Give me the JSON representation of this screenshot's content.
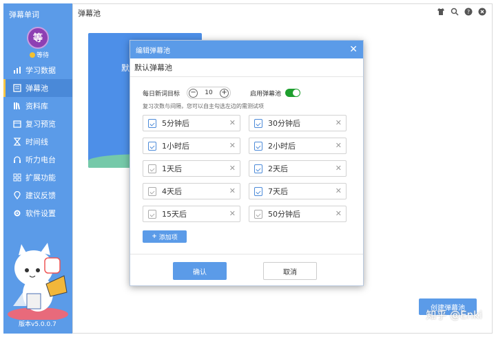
{
  "sidebar": {
    "app_title": "弹幕单词",
    "avatar_char": "等",
    "user_status": "等待",
    "items": [
      {
        "label": "学习数据",
        "icon": "bar-chart-icon"
      },
      {
        "label": "弹幕池",
        "icon": "list-icon"
      },
      {
        "label": "资料库",
        "icon": "books-icon"
      },
      {
        "label": "复习预览",
        "icon": "calendar-icon"
      },
      {
        "label": "时间线",
        "icon": "hourglass-icon"
      },
      {
        "label": "听力电台",
        "icon": "headphones-icon"
      },
      {
        "label": "扩展功能",
        "icon": "grid-icon"
      },
      {
        "label": "建议反馈",
        "icon": "location-icon"
      },
      {
        "label": "软件设置",
        "icon": "gear-icon"
      }
    ],
    "active_index": 1,
    "version": "版本v5.0.0.7"
  },
  "main": {
    "title": "弹幕池",
    "bg_card_text": "默",
    "bottom_button": "创建弹幕池"
  },
  "modal": {
    "title": "编辑弹幕池",
    "pool_name": "默认弹幕池",
    "daily_goal_label": "每日新词目标",
    "daily_goal_value": "10",
    "enable_label": "启用弹幕池",
    "enabled": true,
    "hint": "复习次数与间隔，您可以自主勾选左边的需测试项",
    "review_items": [
      {
        "label": "5分钟后",
        "checked": true
      },
      {
        "label": "30分钟后",
        "checked": true
      },
      {
        "label": "1小时后",
        "checked": true
      },
      {
        "label": "2小时后",
        "checked": true
      },
      {
        "label": "1天后",
        "checked": false
      },
      {
        "label": "2天后",
        "checked": true
      },
      {
        "label": "4天后",
        "checked": false
      },
      {
        "label": "7天后",
        "checked": true
      },
      {
        "label": "15天后",
        "checked": false
      },
      {
        "label": "50分钟后",
        "checked": false
      }
    ],
    "add_label": "添加项",
    "confirm_label": "确认",
    "cancel_label": "取消"
  },
  "watermark": "知乎 @Enki"
}
